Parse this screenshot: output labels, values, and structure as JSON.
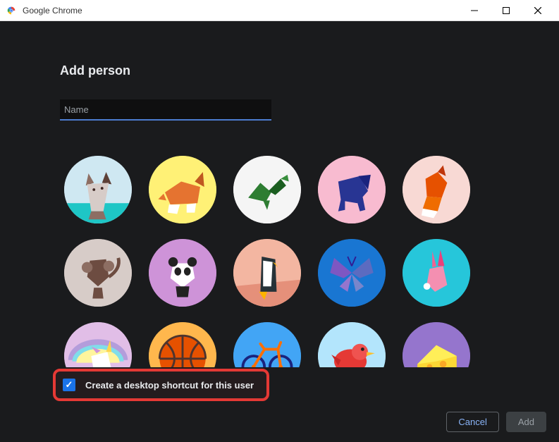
{
  "window": {
    "title": "Google Chrome"
  },
  "dialog": {
    "heading": "Add person",
    "name_placeholder": "Name",
    "name_value": "",
    "shortcut_checkbox_checked": true,
    "shortcut_label": "Create a desktop shortcut for this user",
    "cancel_label": "Cancel",
    "add_label": "Add"
  },
  "avatars": [
    {
      "id": "cat",
      "bg": "#cfe8f2",
      "label": "Origami cat"
    },
    {
      "id": "corgi",
      "bg": "#fff176",
      "label": "Origami corgi"
    },
    {
      "id": "dragon",
      "bg": "#f5f5f5",
      "label": "Origami dragon"
    },
    {
      "id": "elephant",
      "bg": "#f8bbd0",
      "label": "Origami elephant"
    },
    {
      "id": "fox",
      "bg": "#f8d9d4",
      "label": "Origami fox"
    },
    {
      "id": "monkey",
      "bg": "#d7ccc8",
      "label": "Origami monkey"
    },
    {
      "id": "panda",
      "bg": "#ce93d8",
      "label": "Origami panda"
    },
    {
      "id": "penguin",
      "bg": "#f3b6a1",
      "label": "Origami penguin"
    },
    {
      "id": "butterfly",
      "bg": "#1976d2",
      "label": "Origami butterfly"
    },
    {
      "id": "rabbit",
      "bg": "#26c6da",
      "label": "Origami rabbit"
    },
    {
      "id": "unicorn",
      "bg": "#e1bee7",
      "label": "Origami unicorn"
    },
    {
      "id": "basketball",
      "bg": "#ffb74d",
      "label": "Basketball"
    },
    {
      "id": "bicycle",
      "bg": "#42a5f5",
      "label": "Bicycle"
    },
    {
      "id": "bird",
      "bg": "#b3e5fc",
      "label": "Red bird"
    },
    {
      "id": "cheese",
      "bg": "#9575cd",
      "label": "Cheese"
    }
  ]
}
